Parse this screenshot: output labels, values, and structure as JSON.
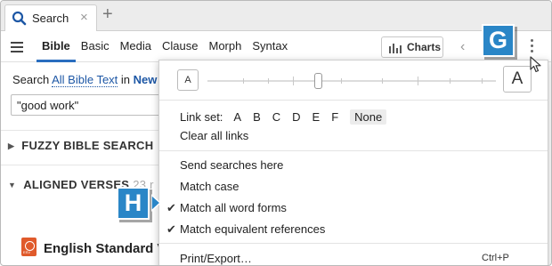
{
  "tab": {
    "title": "Search",
    "close_glyph": "×",
    "new_tab_glyph": "+"
  },
  "toolbar": {
    "tabs": [
      "Bible",
      "Basic",
      "Media",
      "Clause",
      "Morph",
      "Syntax"
    ],
    "active_tab": "Bible",
    "charts_label": "Charts",
    "nav_prev_glyph": "‹"
  },
  "search_scope": {
    "prefix": "Search",
    "scope": "All Bible Text",
    "connector": "in",
    "resource": "New"
  },
  "query": {
    "value": "\"good work\""
  },
  "sections": {
    "fuzzy": "FUZZY BIBLE SEARCH",
    "aligned": "ALIGNED VERSES",
    "aligned_count": "23 r"
  },
  "result": {
    "resource_title": "English Standard V"
  },
  "menu": {
    "font_small": "A",
    "font_large": "A",
    "link_set_label": "Link set:",
    "link_sets": [
      "A",
      "B",
      "C",
      "D",
      "E",
      "F"
    ],
    "link_set_none": "None",
    "clear_links": "Clear all links",
    "send_searches": "Send searches here",
    "match_case": "Match case",
    "match_word_forms": "Match all word forms",
    "match_equivalent": "Match equivalent references",
    "print_export": "Print/Export…",
    "print_shortcut": "Ctrl+P",
    "check_glyph": "✔"
  },
  "callouts": {
    "g": "G",
    "h": "H"
  },
  "colors": {
    "accent": "#2a6ebf",
    "link": "#1d57a5",
    "callout": "#2a86c7",
    "esv": "#e05a2b"
  },
  "icons": [
    "search-icon",
    "close-icon",
    "plus-icon",
    "hamburger-icon",
    "bar-chart-icon",
    "chevron-left-icon",
    "more-vertical-icon",
    "triangle-right-icon",
    "triangle-down-icon",
    "checkmark-icon",
    "esv-logo-icon",
    "mouse-pointer-icon"
  ]
}
